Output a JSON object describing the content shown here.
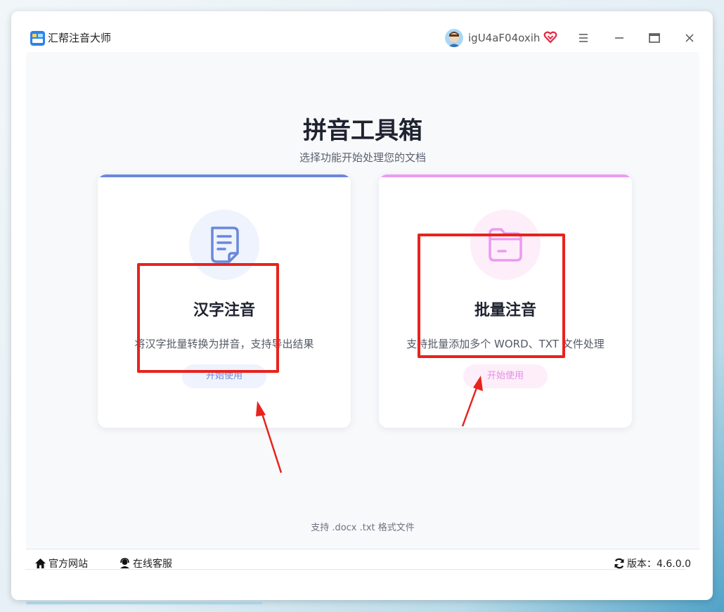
{
  "window": {
    "app_title": "汇帮注音大师",
    "username": "igU4aF04oxih",
    "icons": [
      "app-logo-icon",
      "avatar",
      "vip-heart-icon",
      "menu-icon",
      "minimize-icon",
      "maximize-icon",
      "close-icon"
    ]
  },
  "main": {
    "title": "拼音工具箱",
    "subtitle": "选择功能开始处理您的文档",
    "cards": [
      {
        "title": "汉字注音",
        "description": "将汉字批量转换为拼音，支持导出结果",
        "button": "开始使用",
        "accent": "#6b87dc",
        "icon": "document-icon"
      },
      {
        "title": "批量注音",
        "description": "支持批量添加多个 WORD、TXT 文件处理",
        "button": "开始使用",
        "accent": "#ec9af1",
        "icon": "folder-icon"
      }
    ],
    "supported_formats": "支持 .docx .txt 格式文件"
  },
  "footer": {
    "official_site": "官方网站",
    "online_service": "在线客服",
    "version_label": "版本：",
    "version_value": "4.6.0.0"
  },
  "annotations": {
    "color": "#e8231d"
  }
}
